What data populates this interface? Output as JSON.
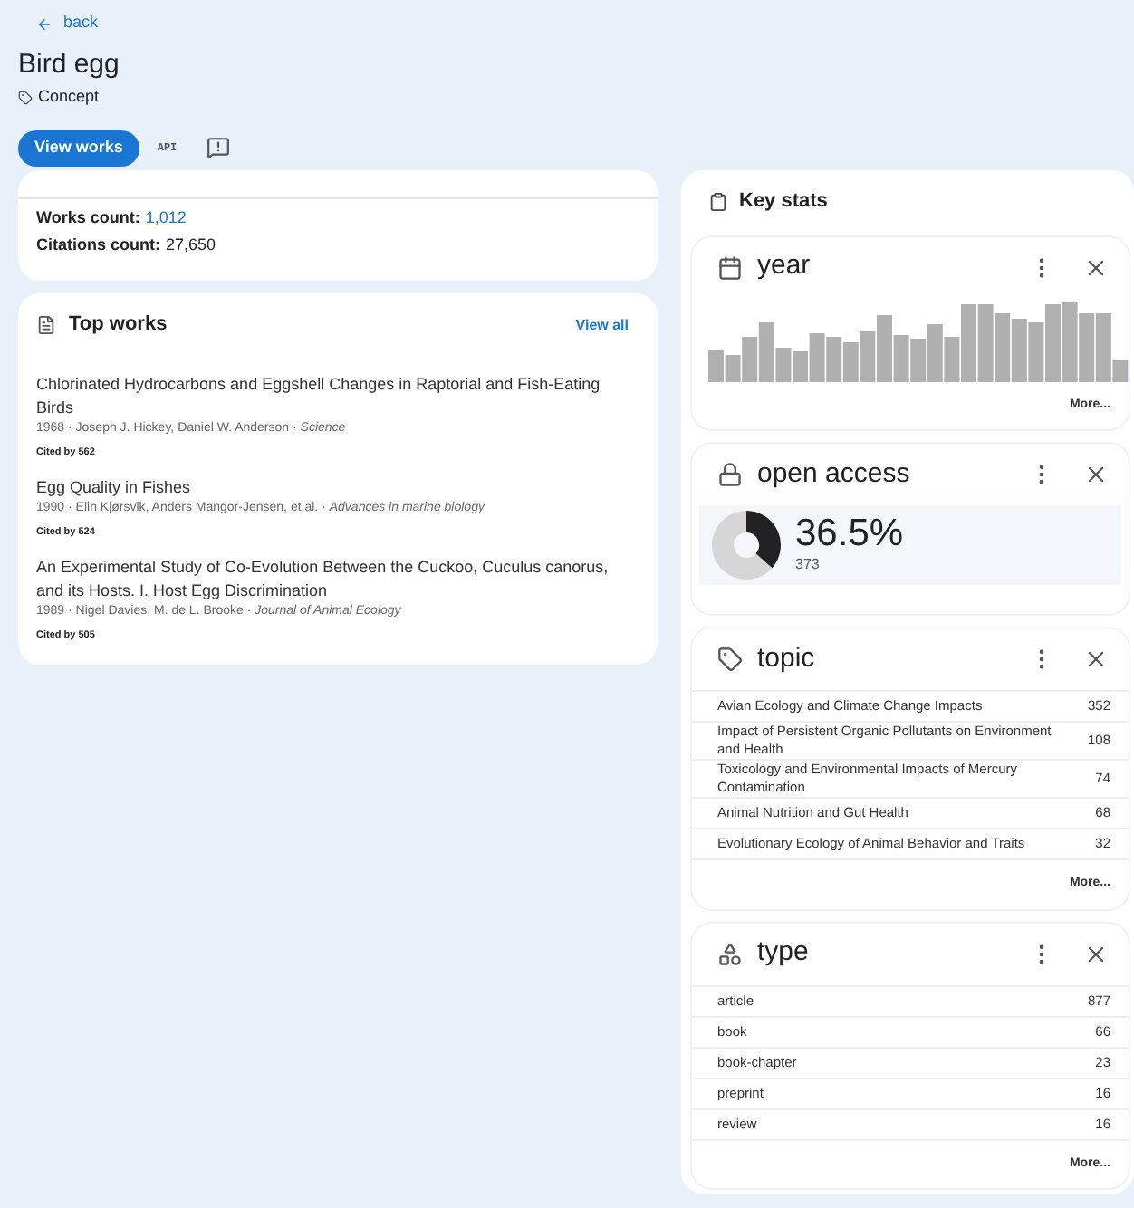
{
  "back_link": "back",
  "title": "Bird egg",
  "entity_type": "Concept",
  "actions": {
    "primary": "View works",
    "api": "API"
  },
  "counts": [
    {
      "label": "Works count:",
      "value": "1,012",
      "link": true
    },
    {
      "label": "Citations count:",
      "value": "27,650",
      "link": false
    }
  ],
  "top_works": {
    "title": "Top works",
    "view_all": "View all",
    "works": [
      {
        "title": "Chlorinated Hydrocarbons and Eggshell Changes in Raptorial and Fish-Eating Birds",
        "meta": "1968 · Joseph J. Hickey, Daniel W. Anderson · ",
        "venue": "Science",
        "cited": "Cited by 562"
      },
      {
        "title": "Egg Quality in Fishes",
        "meta": "1990 · Elin Kjørsvik, Anders Mangor-Jensen, et al. · ",
        "venue": "Advances in marine biology",
        "cited": "Cited by 524"
      },
      {
        "title": "An Experimental Study of Co-Evolution Between the Cuckoo, Cuculus canorus, and its Hosts. I. Host Egg Discrimination",
        "meta": "1989 · Nigel Davies, M. de L. Brooke · ",
        "venue": "Journal of Animal Ecology",
        "cited": "Cited by 505"
      }
    ]
  },
  "key_stats": {
    "title": "Key stats",
    "panels": [
      {
        "kind": "histogram",
        "title": "year",
        "more": "More..."
      },
      {
        "kind": "donut",
        "title": "open access",
        "percent": "36.5%",
        "count": "373"
      },
      {
        "kind": "table",
        "title": "topic",
        "more": "More...",
        "rows": [
          {
            "label": "Avian Ecology and Climate Change Impacts",
            "count": "352"
          },
          {
            "label": "Impact of Persistent Organic Pollutants on Environment and Health",
            "count": "108"
          },
          {
            "label": "Toxicology and Environmental Impacts of Mercury Contamination",
            "count": "74"
          },
          {
            "label": "Animal Nutrition and Gut Health",
            "count": "68"
          },
          {
            "label": "Evolutionary Ecology of Animal Behavior and Traits",
            "count": "32"
          }
        ]
      },
      {
        "kind": "table",
        "title": "type",
        "more": "More...",
        "rows": [
          {
            "label": "article",
            "count": "877"
          },
          {
            "label": "book",
            "count": "66"
          },
          {
            "label": "book-chapter",
            "count": "23"
          },
          {
            "label": "preprint",
            "count": "16"
          },
          {
            "label": "review",
            "count": "16"
          }
        ]
      }
    ]
  }
}
